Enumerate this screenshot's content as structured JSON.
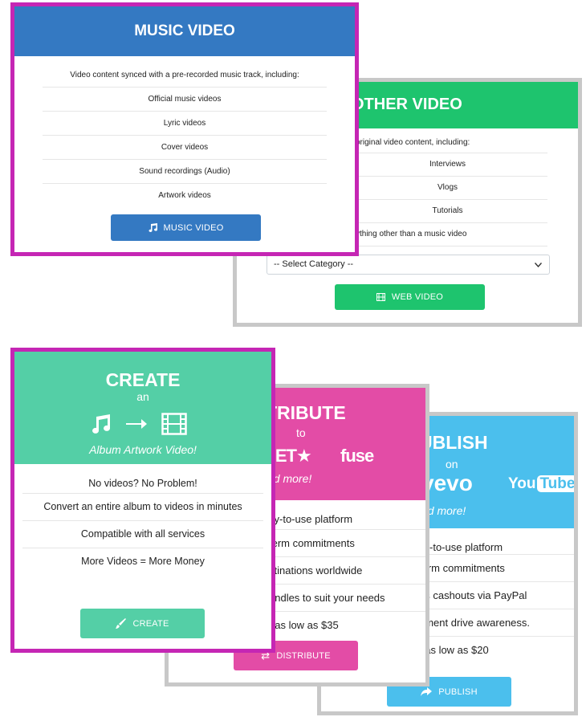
{
  "music_card": {
    "title": "MUSIC VIDEO",
    "intro": "Video content synced with a pre-recorded music track, including:",
    "items": [
      "Official music videos",
      "Lyric videos",
      "Cover videos",
      "Sound recordings (Audio)",
      "Artwork videos"
    ],
    "button_label": "MUSIC VIDEO",
    "button_icon": "music-note-icon",
    "color": "#3479c2"
  },
  "other_card": {
    "title": "OTHER VIDEO",
    "intro": "original video content, including:",
    "items": [
      "Interviews",
      "Vlogs",
      "Tutorials",
      "ything other than a music video"
    ],
    "select_value": "-- Select Category --",
    "button_label": "WEB VIDEO",
    "button_icon": "film-icon",
    "color": "#1ec46e"
  },
  "create_card": {
    "title": "CREATE",
    "subtitle": "an",
    "tagline": "Album Artwork Video!",
    "items": [
      "No videos? No Problem!",
      "Convert an entire album to videos in minutes",
      "Compatible with all services",
      "More Videos = More Money"
    ],
    "button_label": "CREATE",
    "button_icon": "brush-icon",
    "color": "#54cfa6"
  },
  "distribute_card": {
    "title": "TRIBUTE",
    "subtitle": "to",
    "logos": [
      "BET★",
      "fuse"
    ],
    "tagline": "nd more!",
    "items": [
      "sy-to-use platform",
      "term commitments",
      "stinations worldwide",
      "undles to suit your needs",
      "t as low as $35"
    ],
    "button_label": "DISTRIBUTE",
    "button_icon": "shuffle-icon",
    "color": "#e34ca6"
  },
  "publish_card": {
    "title": "UBLISH",
    "subtitle": "on",
    "logos": [
      "vevo",
      "You",
      "Tube"
    ],
    "tagline": "nd more!",
    "items": [
      "sy-to-use platform",
      "term commitments",
      "gs cashouts via PayPal",
      "ement drive awareness.",
      "t as low as $20"
    ],
    "button_label": "PUBLISH",
    "button_icon": "share-arrow-icon",
    "color": "#4bbfed"
  }
}
